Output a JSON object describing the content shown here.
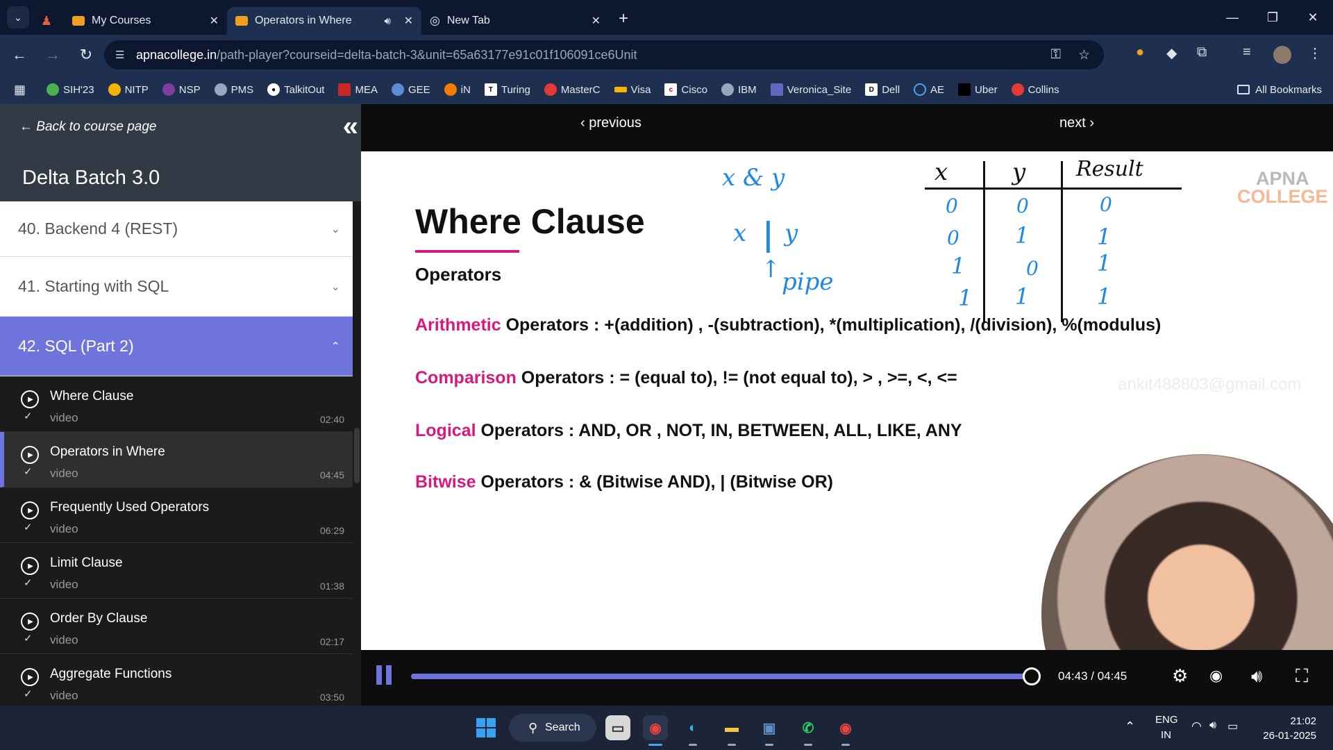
{
  "tabs": [
    {
      "label": "",
      "pinned": true
    },
    {
      "label": "My Courses",
      "close": "✕"
    },
    {
      "label": "Operators in Where",
      "close": "✕",
      "active": true
    },
    {
      "label": "New Tab",
      "close": "✕"
    }
  ],
  "omnibox": {
    "host": "apnacollege.in",
    "path": "/path-player?courseid=delta-batch-3&unit=65a63177e91c01f106091ce6Unit"
  },
  "bookmarks": [
    "SIH'23",
    "NITP",
    "NSP",
    "PMS",
    "TalkitOut",
    "MEA",
    "GEE",
    "iN",
    "Turing",
    "MasterC",
    "Visa",
    "Cisco",
    "IBM",
    "Veronica_Site",
    "Dell",
    "AE",
    "Uber",
    "Collins"
  ],
  "all_bookmarks": "All Bookmarks",
  "sidebar": {
    "back_link": "← Back to course page",
    "collapse_glyph": "«",
    "course_title": "Delta Batch 3.0",
    "sections": [
      {
        "label": "40. Backend 4 (REST)",
        "chev": "⌄"
      },
      {
        "label": "41. Starting with SQL",
        "chev": "⌄"
      },
      {
        "label": "42. SQL (Part 2)",
        "chev": "⌃",
        "active": true
      }
    ],
    "lessons": [
      {
        "title": "Where Clause",
        "type": "video",
        "duration": "02:40"
      },
      {
        "title": "Operators in Where",
        "type": "video",
        "duration": "04:45",
        "active": true
      },
      {
        "title": "Frequently Used Operators",
        "type": "video",
        "duration": "06:29"
      },
      {
        "title": "Limit Clause",
        "type": "video",
        "duration": "01:38"
      },
      {
        "title": "Order By Clause",
        "type": "video",
        "duration": "02:17"
      },
      {
        "title": "Aggregate Functions",
        "type": "video",
        "duration": "03:50"
      }
    ]
  },
  "player": {
    "previous": "‹ previous",
    "next": "next ›",
    "time": "04:43 / 04:45",
    "progress": 0.993
  },
  "slide": {
    "title": "Where Clause",
    "subtitle": "Operators",
    "logo_top": "APNA",
    "logo_bottom": "COLLEGE",
    "watermark": "ankit488803@gmail.com",
    "lines": [
      {
        "hl": "Arithmetic",
        "rest": " Operators : +(addition) , -(subtraction), *(multiplication), /(division), %(modulus)"
      },
      {
        "hl": "Comparison",
        "rest": " Operators : = (equal to), != (not equal to), > , >=, <, <="
      },
      {
        "hl": "Logical",
        "rest": " Operators : AND, OR , NOT, IN, BETWEEN, ALL, LIKE, ANY"
      },
      {
        "hl": "Bitwise",
        "rest": " Operators : & (Bitwise AND), | (Bitwise OR)"
      }
    ],
    "handwriting": {
      "and_expr": "x & y",
      "or_x": "x",
      "or_bar": "|",
      "or_y": "y",
      "arrow": "↑",
      "pipe_label": "pipe",
      "table_headers": [
        "x",
        "y",
        "Result"
      ],
      "table_rows": [
        [
          "0",
          "0",
          "0"
        ],
        [
          "0",
          "1",
          "1"
        ],
        [
          "1",
          "0",
          "1"
        ],
        [
          "1",
          "1",
          "1"
        ]
      ]
    }
  },
  "taskbar": {
    "search": "Search",
    "lang": "ENG",
    "region": "IN",
    "time": "21:02",
    "date": "26-01-2025"
  }
}
